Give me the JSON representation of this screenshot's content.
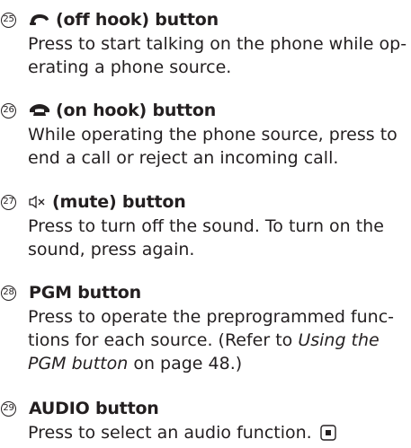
{
  "items": [
    {
      "number": "25",
      "icon": "off-hook-handset-icon",
      "title": "(off hook) button",
      "lines": [
        "Press to start talking on the phone while op-",
        "erating a phone source."
      ]
    },
    {
      "number": "26",
      "icon": "on-hook-handset-icon",
      "title": "(on hook) button",
      "lines": [
        "While operating the phone source, press to",
        "end a call or reject an incoming call."
      ]
    },
    {
      "number": "27",
      "icon": "mute-speaker-icon",
      "title": "(mute) button",
      "lines": [
        "Press to turn off the sound. To turn on the",
        "sound, press again."
      ]
    },
    {
      "number": "28",
      "icon": "",
      "title": "PGM button",
      "lines": [
        "Press to operate the preprogrammed func-",
        "tions for each source. (Refer to ",
        "Using the",
        "PGM button",
        " on page 48.)"
      ]
    },
    {
      "number": "29",
      "icon": "end-of-section-icon",
      "title": "AUDIO button",
      "lines": [
        "Press to select an audio function."
      ]
    }
  ]
}
